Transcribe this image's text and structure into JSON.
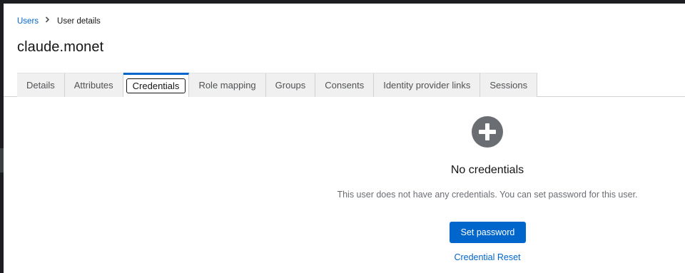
{
  "breadcrumb": {
    "items": [
      "Users",
      "User details"
    ]
  },
  "page": {
    "title": "claude.monet"
  },
  "tabs": [
    {
      "label": "Details"
    },
    {
      "label": "Attributes"
    },
    {
      "label": "Credentials",
      "active": true
    },
    {
      "label": "Role mapping"
    },
    {
      "label": "Groups"
    },
    {
      "label": "Consents"
    },
    {
      "label": "Identity provider links"
    },
    {
      "label": "Sessions"
    }
  ],
  "empty_state": {
    "icon": "plus-circle-icon",
    "title": "No credentials",
    "body": "This user does not have any credentials. You can set password for this user.",
    "primary_action": "Set password",
    "secondary_action": "Credential Reset"
  },
  "colors": {
    "accent": "#0066cc",
    "icon_gray": "#6a6e73",
    "tab_bg": "#f0f0f0",
    "frame_dark": "#1b1d21"
  }
}
